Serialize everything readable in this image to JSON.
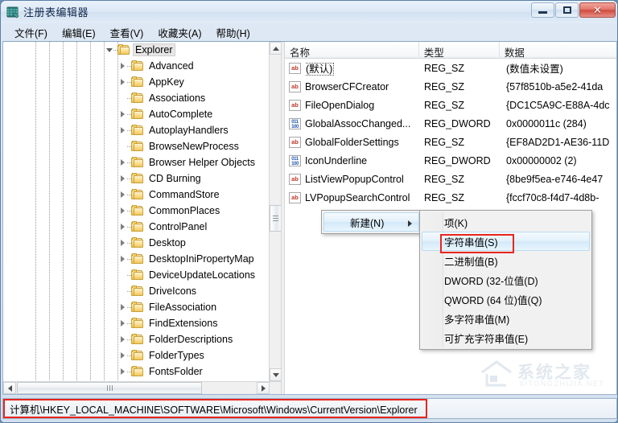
{
  "window": {
    "title": "注册表编辑器",
    "icon": "registry-editor-icon",
    "buttons": {
      "minimize": "–",
      "maximize": "□",
      "close": "✕"
    }
  },
  "menubar": {
    "items": [
      {
        "label": "文件(F)",
        "name": "menu-file"
      },
      {
        "label": "编辑(E)",
        "name": "menu-edit"
      },
      {
        "label": "查看(V)",
        "name": "menu-view"
      },
      {
        "label": "收藏夹(A)",
        "name": "menu-favorites"
      },
      {
        "label": "帮助(H)",
        "name": "menu-help"
      }
    ]
  },
  "tree": {
    "selected": "Explorer",
    "items": [
      {
        "label": "Explorer",
        "depth": 0,
        "expander": "open",
        "selected": true
      },
      {
        "label": "Advanced",
        "depth": 1,
        "expander": "collapsed",
        "selected": false
      },
      {
        "label": "AppKey",
        "depth": 1,
        "expander": "collapsed",
        "selected": false
      },
      {
        "label": "Associations",
        "depth": 1,
        "expander": "none",
        "selected": false
      },
      {
        "label": "AutoComplete",
        "depth": 1,
        "expander": "collapsed",
        "selected": false
      },
      {
        "label": "AutoplayHandlers",
        "depth": 1,
        "expander": "collapsed",
        "selected": false
      },
      {
        "label": "BrowseNewProcess",
        "depth": 1,
        "expander": "none",
        "selected": false
      },
      {
        "label": "Browser Helper Objects",
        "depth": 1,
        "expander": "collapsed",
        "selected": false
      },
      {
        "label": "CD Burning",
        "depth": 1,
        "expander": "collapsed",
        "selected": false
      },
      {
        "label": "CommandStore",
        "depth": 1,
        "expander": "collapsed",
        "selected": false
      },
      {
        "label": "CommonPlaces",
        "depth": 1,
        "expander": "collapsed",
        "selected": false
      },
      {
        "label": "ControlPanel",
        "depth": 1,
        "expander": "collapsed",
        "selected": false
      },
      {
        "label": "Desktop",
        "depth": 1,
        "expander": "collapsed",
        "selected": false
      },
      {
        "label": "DesktopIniPropertyMap",
        "depth": 1,
        "expander": "collapsed",
        "selected": false
      },
      {
        "label": "DeviceUpdateLocations",
        "depth": 1,
        "expander": "none",
        "selected": false
      },
      {
        "label": "DriveIcons",
        "depth": 1,
        "expander": "none",
        "selected": false
      },
      {
        "label": "FileAssociation",
        "depth": 1,
        "expander": "collapsed",
        "selected": false
      },
      {
        "label": "FindExtensions",
        "depth": 1,
        "expander": "collapsed",
        "selected": false
      },
      {
        "label": "FolderDescriptions",
        "depth": 1,
        "expander": "collapsed",
        "selected": false
      },
      {
        "label": "FolderTypes",
        "depth": 1,
        "expander": "collapsed",
        "selected": false
      },
      {
        "label": "FontsFolder",
        "depth": 1,
        "expander": "collapsed",
        "selected": false
      }
    ]
  },
  "list": {
    "columns": [
      {
        "label": "名称",
        "name": "column-name"
      },
      {
        "label": "类型",
        "name": "column-type"
      },
      {
        "label": "数据",
        "name": "column-data"
      }
    ],
    "rows": [
      {
        "name": "(默认)",
        "type": "REG_SZ",
        "data": "(数值未设置)",
        "icon": "string-value-icon",
        "focused": true
      },
      {
        "name": "BrowserCFCreator",
        "type": "REG_SZ",
        "data": "{57f8510b-a5e2-41da",
        "icon": "string-value-icon",
        "focused": false
      },
      {
        "name": "FileOpenDialog",
        "type": "REG_SZ",
        "data": "{DC1C5A9C-E88A-4dc",
        "icon": "string-value-icon",
        "focused": false
      },
      {
        "name": "GlobalAssocChanged...",
        "type": "REG_DWORD",
        "data": "0x0000011c (284)",
        "icon": "dword-value-icon",
        "focused": false
      },
      {
        "name": "GlobalFolderSettings",
        "type": "REG_SZ",
        "data": "{EF8AD2D1-AE36-11D",
        "icon": "string-value-icon",
        "focused": false
      },
      {
        "name": "IconUnderline",
        "type": "REG_DWORD",
        "data": "0x00000002 (2)",
        "icon": "dword-value-icon",
        "focused": false
      },
      {
        "name": "ListViewPopupControl",
        "type": "REG_SZ",
        "data": "{8be9f5ea-e746-4e47",
        "icon": "string-value-icon",
        "focused": false
      },
      {
        "name": "LVPopupSearchControl",
        "type": "REG_SZ",
        "data": "{fccf70c8-f4d7-4d8b-",
        "icon": "string-value-icon",
        "focused": false
      }
    ]
  },
  "context_menu": {
    "parent_item": {
      "label": "新建(N)",
      "highlighted": true
    },
    "submenu": [
      {
        "label": "项(K)",
        "highlighted": false
      },
      {
        "label": "字符串值(S)",
        "highlighted": true
      },
      {
        "label": "二进制值(B)",
        "highlighted": false
      },
      {
        "label": "DWORD (32-位值(D)",
        "highlighted": false
      },
      {
        "label": "QWORD (64 位)值(Q)",
        "highlighted": false
      },
      {
        "label": "多字符串值(M)",
        "highlighted": false
      },
      {
        "label": "可扩充字符串值(E)",
        "highlighted": false
      }
    ]
  },
  "statusbar": {
    "path": "计算机\\HKEY_LOCAL_MACHINE\\SOFTWARE\\Microsoft\\Windows\\CurrentVersion\\Explorer"
  },
  "watermark": {
    "text": "系统之家",
    "subtext": "XITONGZHIJIA.NET"
  },
  "colors": {
    "annotation": "#e8251d",
    "close_button": "#cf4a3d",
    "string_icon": "#c0392b",
    "dword_icon": "#2a5db0",
    "folder": "#f0c75c"
  }
}
